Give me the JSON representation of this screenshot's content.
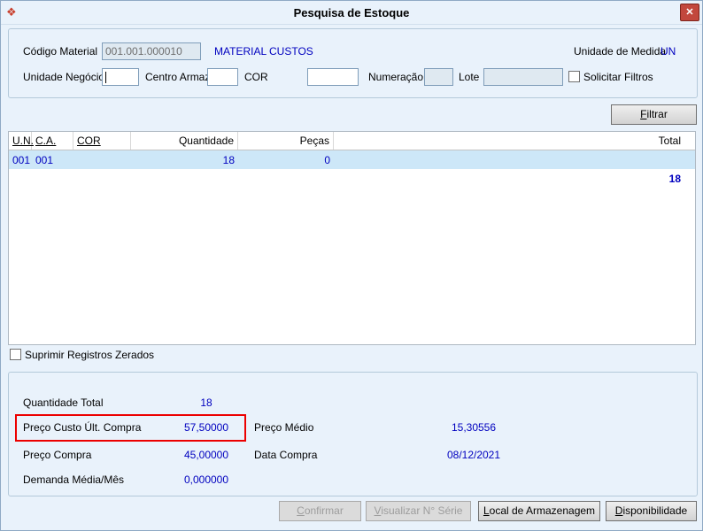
{
  "window": {
    "title": "Pesquisa de Estoque"
  },
  "icons": {
    "app_icon": "❖",
    "close_icon": "✕"
  },
  "filters": {
    "codigo_material": {
      "label": "Código Material",
      "value": "001.001.000010"
    },
    "material_desc": "MATERIAL CUSTOS",
    "unidade_medida": {
      "label": "Unidade de Medida",
      "value": "UN"
    },
    "unidade_negocio": {
      "label": "Unidade Negócio",
      "value": ""
    },
    "centro_armaz": {
      "label": "Centro Armaz.",
      "value": ""
    },
    "cor": {
      "label": "COR",
      "value": ""
    },
    "numeracao": {
      "label": "Numeração",
      "value": ""
    },
    "lote": {
      "label": "Lote",
      "value": ""
    },
    "solicitar_filtros": {
      "label": "Solicitar Filtros",
      "checked": false
    },
    "filtrar_button": "Filtrar"
  },
  "table": {
    "headers": {
      "un": "U.N.",
      "ca": "C.A.",
      "cor": "COR",
      "quantidade": "Quantidade",
      "pecas": "Peças",
      "total": "Total"
    },
    "rows": [
      {
        "un": "001",
        "ca": "001",
        "cor": "",
        "quantidade": "18",
        "pecas": "0"
      }
    ],
    "total": "18"
  },
  "suprimir": {
    "label": "Suprimir Registros Zerados",
    "checked": false
  },
  "summary": {
    "quantidade_total": {
      "label": "Quantidade Total",
      "value": "18"
    },
    "preco_custo": {
      "label": "Preço Custo Últ. Compra",
      "value": "57,50000"
    },
    "preco_medio": {
      "label": "Preço Médio",
      "value": "15,30556"
    },
    "preco_compra": {
      "label": "Preço Compra",
      "value": "45,00000"
    },
    "data_compra": {
      "label": "Data Compra",
      "value": "08/12/2021"
    },
    "demanda": {
      "label": "Demanda Média/Mês",
      "value": "0,000000"
    }
  },
  "footer": {
    "confirmar": "Confirmar",
    "visualizar": "Visualizar N° Série",
    "local_armazenagem": "Local de Armazenagem",
    "disponibilidade": "Disponibilidade"
  },
  "colors": {
    "value_text": "#0000bf",
    "selected_row": "#cde7f8",
    "annotation": "#ec0000",
    "close_button": "#c2473d"
  }
}
